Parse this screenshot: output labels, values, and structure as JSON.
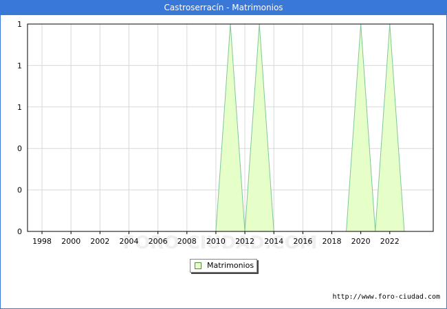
{
  "window": {
    "title": "Castroserracín - Matrimonios"
  },
  "legend": {
    "label": "Matrimonios"
  },
  "footer": {
    "credit": "http://www.foro-ciudad.com"
  },
  "watermark": "FORO-CIUDAD.COM",
  "colors": {
    "title_bg": "#3a78d8",
    "area_fill": "#e6ffc8",
    "area_stroke": "#7fc79a",
    "grid": "#d8d8d8"
  },
  "chart_data": {
    "type": "area",
    "title": "Castroserracín - Matrimonios",
    "xlabel": "",
    "ylabel": "",
    "x": [
      1997,
      1998,
      1999,
      2000,
      2001,
      2002,
      2003,
      2004,
      2005,
      2006,
      2007,
      2008,
      2009,
      2010,
      2011,
      2012,
      2013,
      2014,
      2015,
      2016,
      2017,
      2018,
      2019,
      2020,
      2021,
      2022,
      2023
    ],
    "series": [
      {
        "name": "Matrimonios",
        "values": [
          0,
          0,
          0,
          0,
          0,
          0,
          0,
          0,
          0,
          0,
          0,
          0,
          0,
          0,
          1,
          0,
          1,
          0,
          0,
          0,
          0,
          0,
          0,
          1,
          0,
          1,
          0
        ]
      }
    ],
    "xticks": [
      "1998",
      "2000",
      "2002",
      "2004",
      "2006",
      "2008",
      "2010",
      "2012",
      "2014",
      "2016",
      "2018",
      "2020",
      "2022"
    ],
    "yticks": [
      "0",
      "0",
      "0",
      "1",
      "1",
      "1"
    ],
    "ylim": [
      0,
      1
    ],
    "grid": true,
    "legend_position": "bottom-center"
  }
}
